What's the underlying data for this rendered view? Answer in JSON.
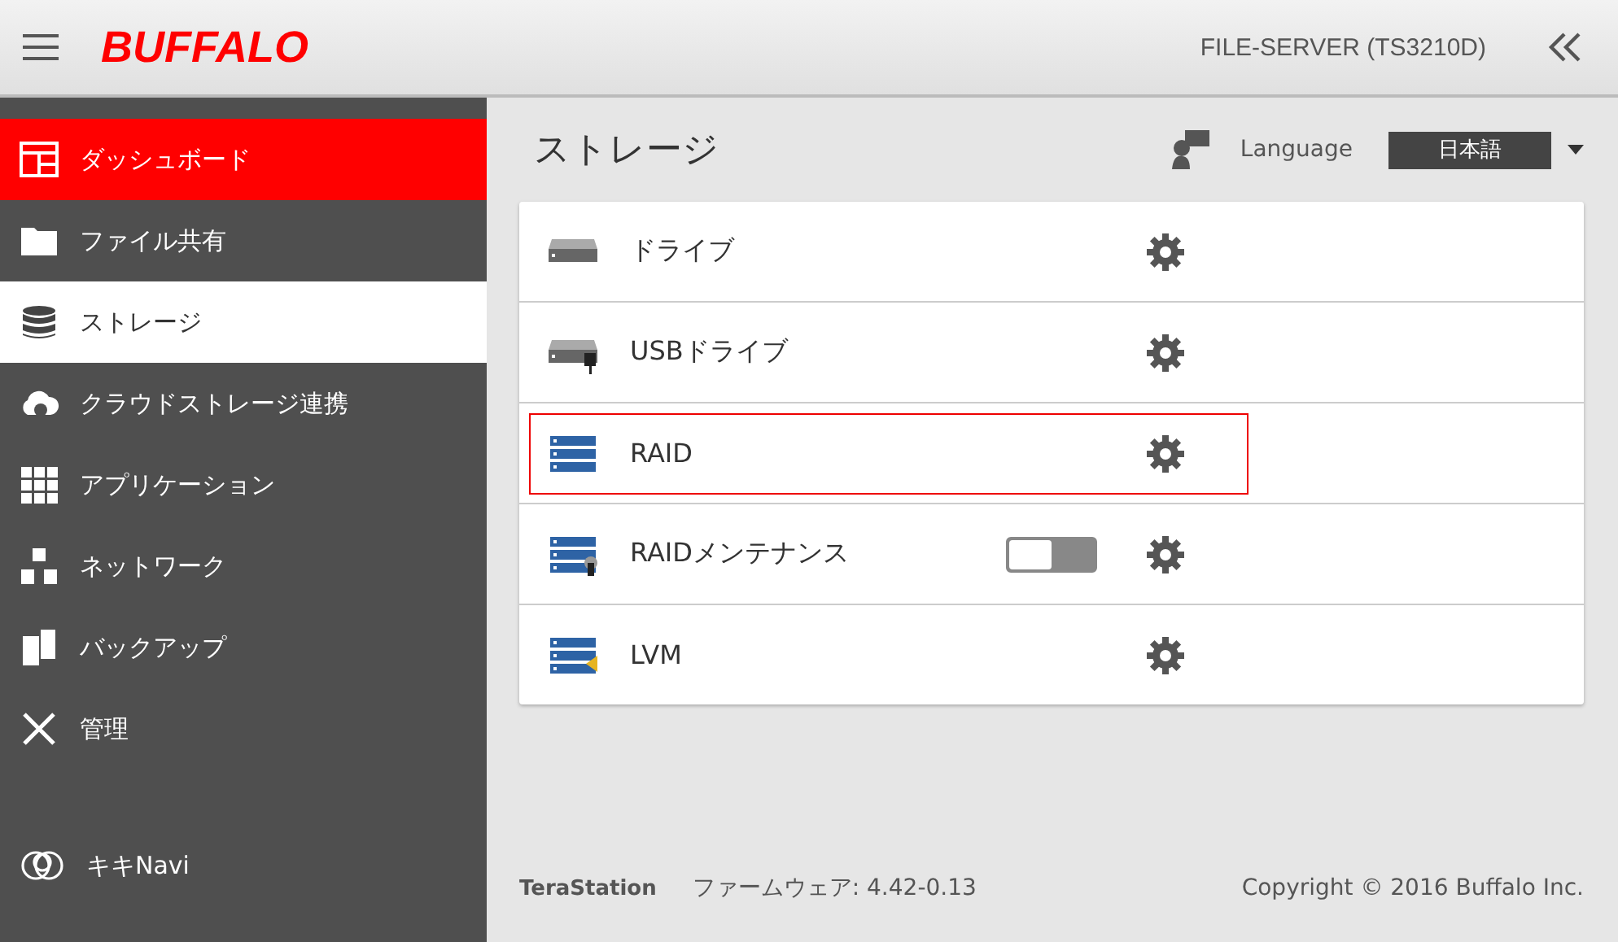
{
  "header": {
    "logo": "BUFFALO",
    "device": "FILE-SERVER (TS3210D)"
  },
  "sidebar": {
    "items": [
      {
        "kind": "dashboard",
        "label": "ダッシュボード",
        "highlighted": true,
        "selected": false
      },
      {
        "kind": "folder",
        "label": "ファイル共有",
        "highlighted": false,
        "selected": false
      },
      {
        "kind": "storage",
        "label": "ストレージ",
        "highlighted": false,
        "selected": true
      },
      {
        "kind": "cloud",
        "label": "クラウドストレージ連携",
        "highlighted": false,
        "selected": false
      },
      {
        "kind": "apps",
        "label": "アプリケーション",
        "highlighted": false,
        "selected": false
      },
      {
        "kind": "network",
        "label": "ネットワーク",
        "highlighted": false,
        "selected": false
      },
      {
        "kind": "backup",
        "label": "バックアップ",
        "highlighted": false,
        "selected": false
      },
      {
        "kind": "admin",
        "label": "管理",
        "highlighted": false,
        "selected": false
      }
    ],
    "bottom": {
      "kind": "kikinavi",
      "label": "キキNavi"
    }
  },
  "page": {
    "title": "ストレージ",
    "language_label": "Language",
    "language_value": "日本語"
  },
  "rows": [
    {
      "kind": "drive",
      "label": "ドライブ",
      "focused": false
    },
    {
      "kind": "usb",
      "label": "USBドライブ",
      "focused": false
    },
    {
      "kind": "raid",
      "label": "RAID",
      "focused": true
    },
    {
      "kind": "raid-maint",
      "label": "RAIDメンテナンス",
      "focused": false,
      "toggle": {
        "on": false
      }
    },
    {
      "kind": "lvm",
      "label": "LVM",
      "focused": false
    }
  ],
  "footer": {
    "brand": "TeraStation",
    "firmware": "ファームウェア: 4.42-0.13",
    "copyright": "Copyright © 2016 Buffalo Inc."
  }
}
